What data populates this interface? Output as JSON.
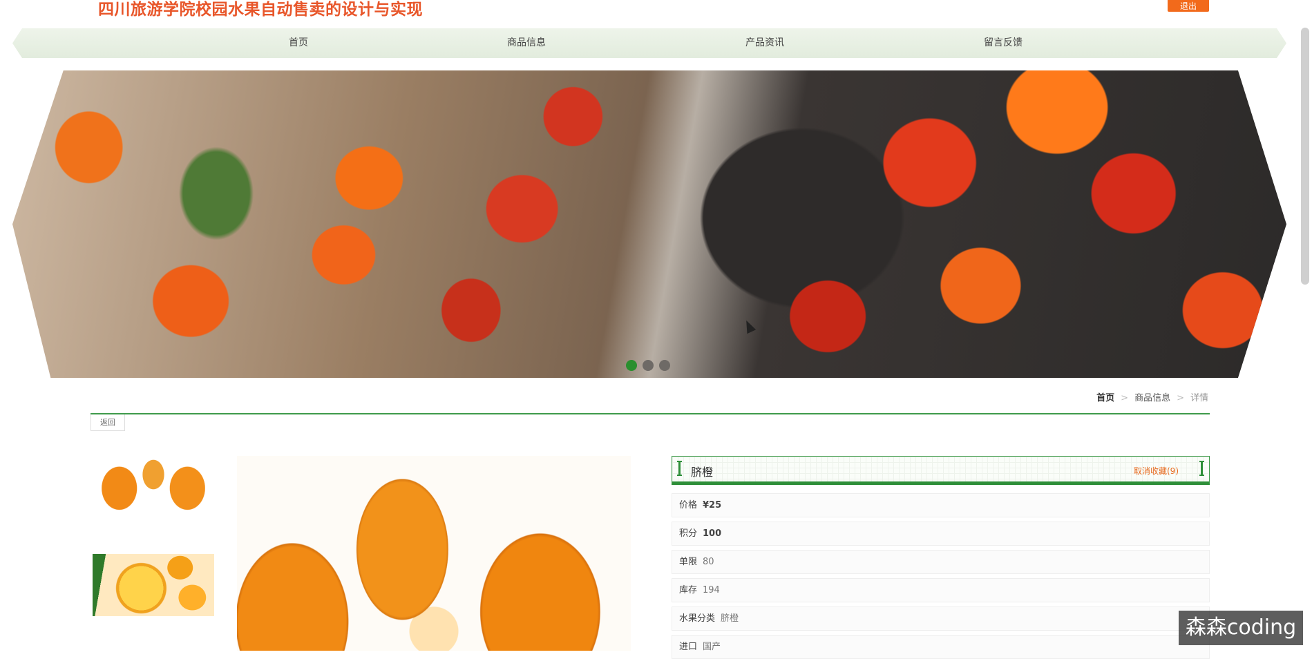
{
  "header": {
    "site_title": "四川旅游学院校园水果自动售卖的设计与实现",
    "logout_label": "退出"
  },
  "nav": {
    "items": [
      {
        "label": "首页"
      },
      {
        "label": "商品信息"
      },
      {
        "label": "产品资讯"
      },
      {
        "label": "留言反馈"
      }
    ]
  },
  "carousel": {
    "slides": 3,
    "active_index": 0
  },
  "breadcrumb": {
    "home": "首页",
    "sep1": ">",
    "list": "商品信息",
    "sep2": ">",
    "current": "详情"
  },
  "back_label": "返回",
  "product": {
    "name": "脐橙",
    "favorite_label": "取消收藏(9)",
    "fields": [
      {
        "label": "价格",
        "value": "¥25"
      },
      {
        "label": "积分",
        "value": "100"
      },
      {
        "label": "单限",
        "value": "80"
      },
      {
        "label": "库存",
        "value": "194"
      },
      {
        "label": "水果分类",
        "value": "脐橙"
      },
      {
        "label": "进口",
        "value": "国产"
      }
    ]
  },
  "watermark": "森森coding",
  "colors": {
    "accent_orange": "#f26a1b",
    "title_orange": "#e8562a",
    "brand_green": "#2e8f39"
  }
}
